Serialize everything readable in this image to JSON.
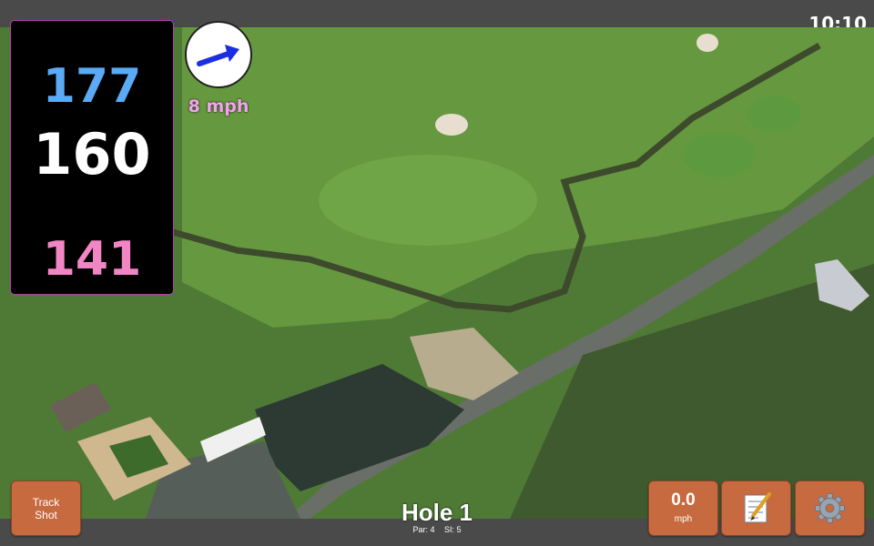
{
  "status": {
    "time": "10:10"
  },
  "distances": {
    "back": "177",
    "center": "160",
    "front": "141"
  },
  "wind": {
    "speed_label": "8 mph",
    "icon": "wind-direction-arrow-icon"
  },
  "hole": {
    "title": "Hole 1",
    "par": "Par: 4",
    "si": "SI: 5"
  },
  "buttons": {
    "track_shot_line1": "Track",
    "track_shot_line2": "Shot",
    "speed_value": "0.0",
    "speed_unit": "mph",
    "notes_icon": "notepad-icon",
    "settings_icon": "gear-icon"
  },
  "colors": {
    "back": "#5aaaf5",
    "center": "#ffffff",
    "front": "#f286c4",
    "wind_text": "#f4a3f0",
    "button": "#c86a3f"
  }
}
